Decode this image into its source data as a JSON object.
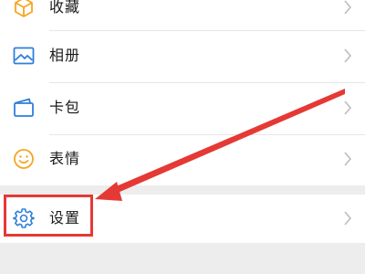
{
  "menu": {
    "items": [
      {
        "label": "收藏",
        "icon": "cube-favorites-icon"
      },
      {
        "label": "相册",
        "icon": "photo-album-icon"
      },
      {
        "label": "卡包",
        "icon": "card-wallet-icon"
      },
      {
        "label": "表情",
        "icon": "smiley-emoji-icon"
      }
    ],
    "settings": {
      "label": "设置",
      "icon": "gear-icon"
    }
  },
  "colors": {
    "icon_blue": "#2f7fd8",
    "icon_yellow": "#f5a623",
    "annotation_red": "#e53935",
    "chevron_gray": "#bdbdbd",
    "page_bg": "#ededed"
  }
}
